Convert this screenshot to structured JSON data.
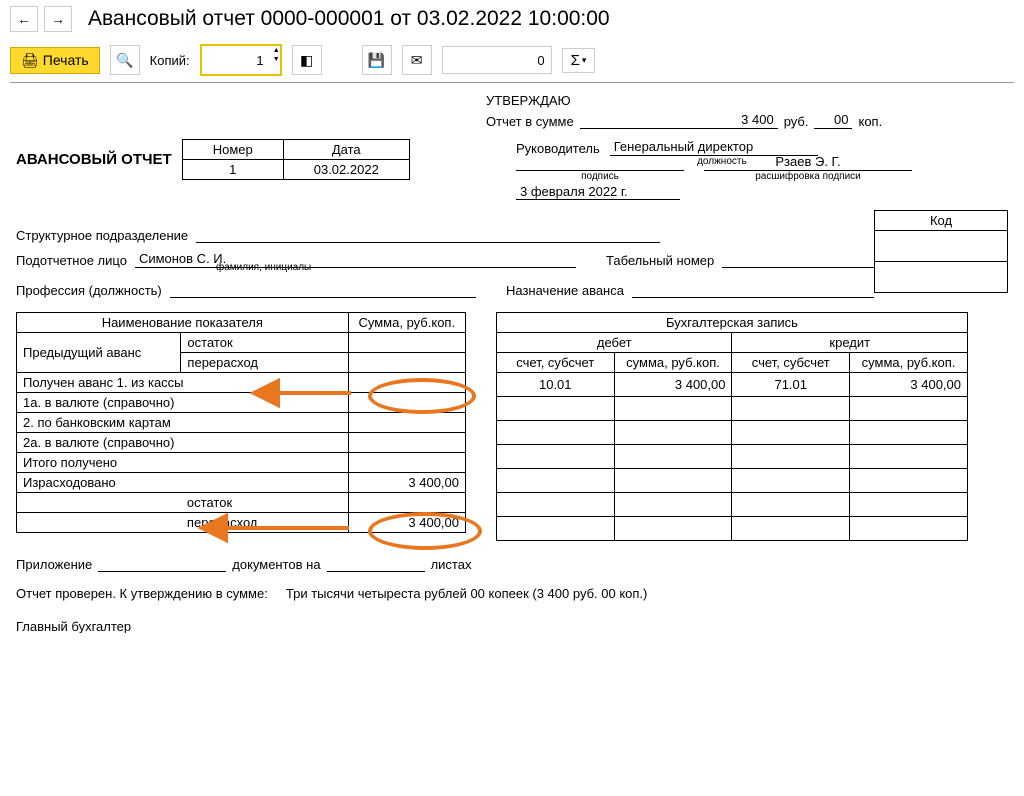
{
  "nav": {
    "back": "←",
    "forward": "→"
  },
  "window_title": "Авансовый отчет 0000-000001 от 03.02.2022 10:00:00",
  "toolbar": {
    "print": "Печать",
    "copies_label": "Копий:",
    "copies_value": "1",
    "num_value": "0",
    "sigma": "Σ",
    "sigma_caret": "▾"
  },
  "approve": {
    "title": "УТВЕРЖДАЮ",
    "sum_label": "Отчет в сумме",
    "sum_rub": "3 400",
    "rub": "руб.",
    "sum_kop": "00",
    "kop": "коп.",
    "manager_label": "Руководитель",
    "manager_pos": "Генеральный директор",
    "pos_caption": "должность",
    "sig_caption": "подпись",
    "decode_caption": "расшифровка подписи",
    "decode_val": "Рзаев Э. Г.",
    "date_text": "3 февраля 2022 г."
  },
  "header": {
    "title": "АВАНСОВЫЙ ОТЧЕТ",
    "num_h": "Номер",
    "date_h": "Дата",
    "num": "1",
    "date": "03.02.2022"
  },
  "code_label": "Код",
  "fields": {
    "subdiv": "Структурное подразделение",
    "person_label": "Подотчетное лицо",
    "person": "Симонов С. И.",
    "person_caption": "фамилия, инициалы",
    "tabnum": "Табельный номер",
    "prof": "Профессия (должность)",
    "purpose": "Назначение аванса"
  },
  "left": {
    "name_head": "Наименование показателя",
    "sum_head": "Сумма, руб.коп.",
    "prev": "Предыдущий аванс",
    "remain": "остаток",
    "over": "перерасход",
    "recv_cash": "Получен аванс 1. из кассы",
    "curr1": "1а. в валюте (справочно)",
    "bank": "2. по банковским картам",
    "curr2": "2а. в валюте (справочно)",
    "total_recv": "Итого получено",
    "spent": "Израсходовано",
    "spent_val": "3 400,00",
    "remain2": "остаток",
    "over2": "перерасход",
    "over2_val": "3 400,00"
  },
  "right": {
    "head": "Бухгалтерская запись",
    "debit": "дебет",
    "credit": "кредит",
    "acc": "счет, субсчет",
    "sum": "сумма, руб.коп.",
    "d_acc": "10.01",
    "d_sum": "3 400,00",
    "c_acc": "71.01",
    "c_sum": "3 400,00"
  },
  "attach": {
    "label": "Приложение",
    "docs": "документов на",
    "sheets": "листах"
  },
  "summary": {
    "prefix": "Отчет проверен. К утверждению в сумме:",
    "words": "Три тысячи четыреста рублей 00 копеек (3 400 руб. 00 коп.)"
  },
  "cutoff": "Главный бухгалтер"
}
